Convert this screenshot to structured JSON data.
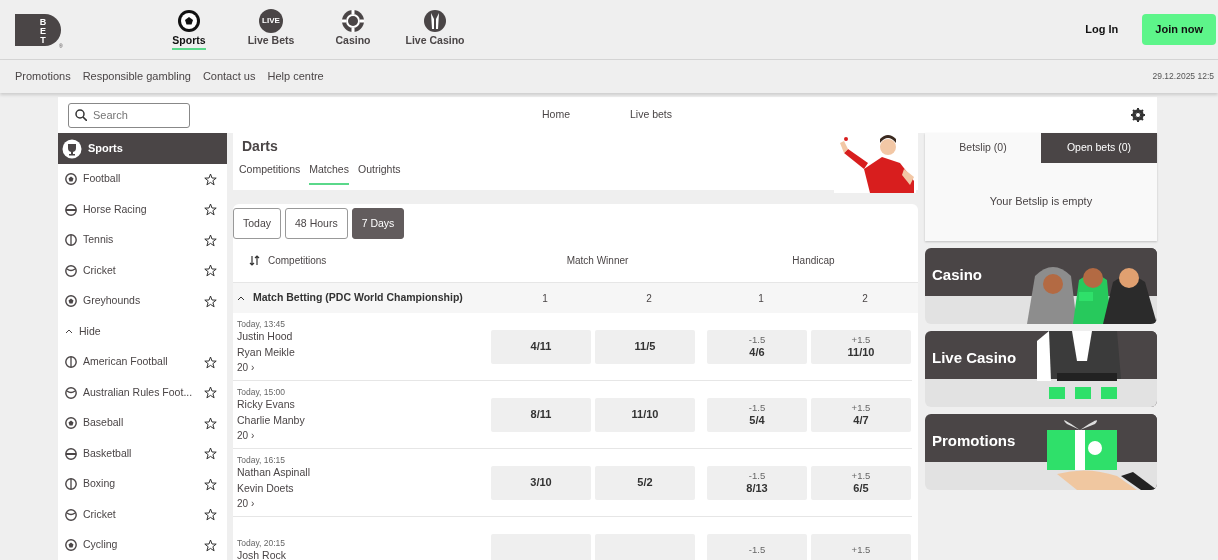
{
  "logo": {
    "letters": "BET",
    "mark": "®"
  },
  "top_nav": [
    {
      "label": "Sports",
      "selected": true
    },
    {
      "label": "Live Bets",
      "badge": "LIVE",
      "selected": false
    },
    {
      "label": "Casino",
      "selected": false
    },
    {
      "label": "Live Casino",
      "selected": false
    }
  ],
  "account": {
    "login": "Log In",
    "join": "Join now"
  },
  "sub_nav": [
    "Promotions",
    "Responsible gambling",
    "Contact us",
    "Help centre"
  ],
  "datetime": "29.12.2025 12:5",
  "search": {
    "placeholder": "Search"
  },
  "main_nav": [
    "Home",
    "Live bets"
  ],
  "sidebar": {
    "title": "Sports",
    "items": [
      {
        "kind": "sport",
        "label": "Football"
      },
      {
        "kind": "sport",
        "label": "Horse Racing"
      },
      {
        "kind": "sport",
        "label": "Tennis"
      },
      {
        "kind": "sport",
        "label": "Cricket"
      },
      {
        "kind": "sport",
        "label": "Greyhounds"
      },
      {
        "kind": "toggle",
        "label": "Hide",
        "expanded": true
      },
      {
        "kind": "sport",
        "label": "American Football"
      },
      {
        "kind": "sport",
        "label": "Australian Rules Foot..."
      },
      {
        "kind": "sport",
        "label": "Baseball"
      },
      {
        "kind": "sport",
        "label": "Basketball"
      },
      {
        "kind": "sport",
        "label": "Boxing"
      },
      {
        "kind": "sport",
        "label": "Cricket"
      },
      {
        "kind": "sport",
        "label": "Cycling"
      }
    ]
  },
  "event": {
    "title": "Darts",
    "tabs": [
      {
        "label": "Competitions",
        "selected": false
      },
      {
        "label": "Matches",
        "selected": true
      },
      {
        "label": "Outrights",
        "selected": false
      }
    ]
  },
  "filters": [
    {
      "label": "Today",
      "selected": false
    },
    {
      "label": "48 Hours",
      "selected": false
    },
    {
      "label": "7 Days",
      "selected": true
    }
  ],
  "markets": {
    "sort_label": "Competitions",
    "columns": [
      {
        "title": "Match Winner",
        "outcomes": [
          "1",
          "2"
        ]
      },
      {
        "title": "Handicap",
        "outcomes": [
          "1",
          "2"
        ]
      }
    ]
  },
  "group": {
    "title": "Match Betting (PDC World Championship)",
    "expanded": true
  },
  "matches": [
    {
      "time": "Today, 13:45",
      "players": [
        "Justin Hood",
        "Ryan Meikle"
      ],
      "more": "20 ›",
      "match_winner": [
        {
          "price": "4/11"
        },
        {
          "price": "11/5"
        }
      ],
      "handicap": [
        {
          "line": "-1.5",
          "price": "4/6"
        },
        {
          "line": "+1.5",
          "price": "11/10"
        }
      ]
    },
    {
      "time": "Today, 15:00",
      "players": [
        "Ricky Evans",
        "Charlie Manby"
      ],
      "more": "20 ›",
      "match_winner": [
        {
          "price": "8/11"
        },
        {
          "price": "11/10"
        }
      ],
      "handicap": [
        {
          "line": "-1.5",
          "price": "5/4"
        },
        {
          "line": "+1.5",
          "price": "4/7"
        }
      ]
    },
    {
      "time": "Today, 16:15",
      "players": [
        "Nathan Aspinall",
        "Kevin Doets"
      ],
      "more": "20 ›",
      "match_winner": [
        {
          "price": "3/10"
        },
        {
          "price": "5/2"
        }
      ],
      "handicap": [
        {
          "line": "-1.5",
          "price": "8/13"
        },
        {
          "line": "+1.5",
          "price": "6/5"
        }
      ]
    },
    {
      "time": "Today, 20:15",
      "players": [
        "Josh Rock"
      ],
      "handicap": [
        {
          "line": "-1.5"
        },
        {
          "line": "+1.5"
        }
      ]
    }
  ],
  "betslip": {
    "tabs": [
      {
        "label": "Betslip (0)",
        "selected": true
      },
      {
        "label": "Open bets (0)",
        "selected": false
      }
    ],
    "empty_text": "Your Betslip is empty"
  },
  "promos": [
    {
      "title": "Casino"
    },
    {
      "title": "Live Casino"
    },
    {
      "title": "Promotions"
    }
  ]
}
